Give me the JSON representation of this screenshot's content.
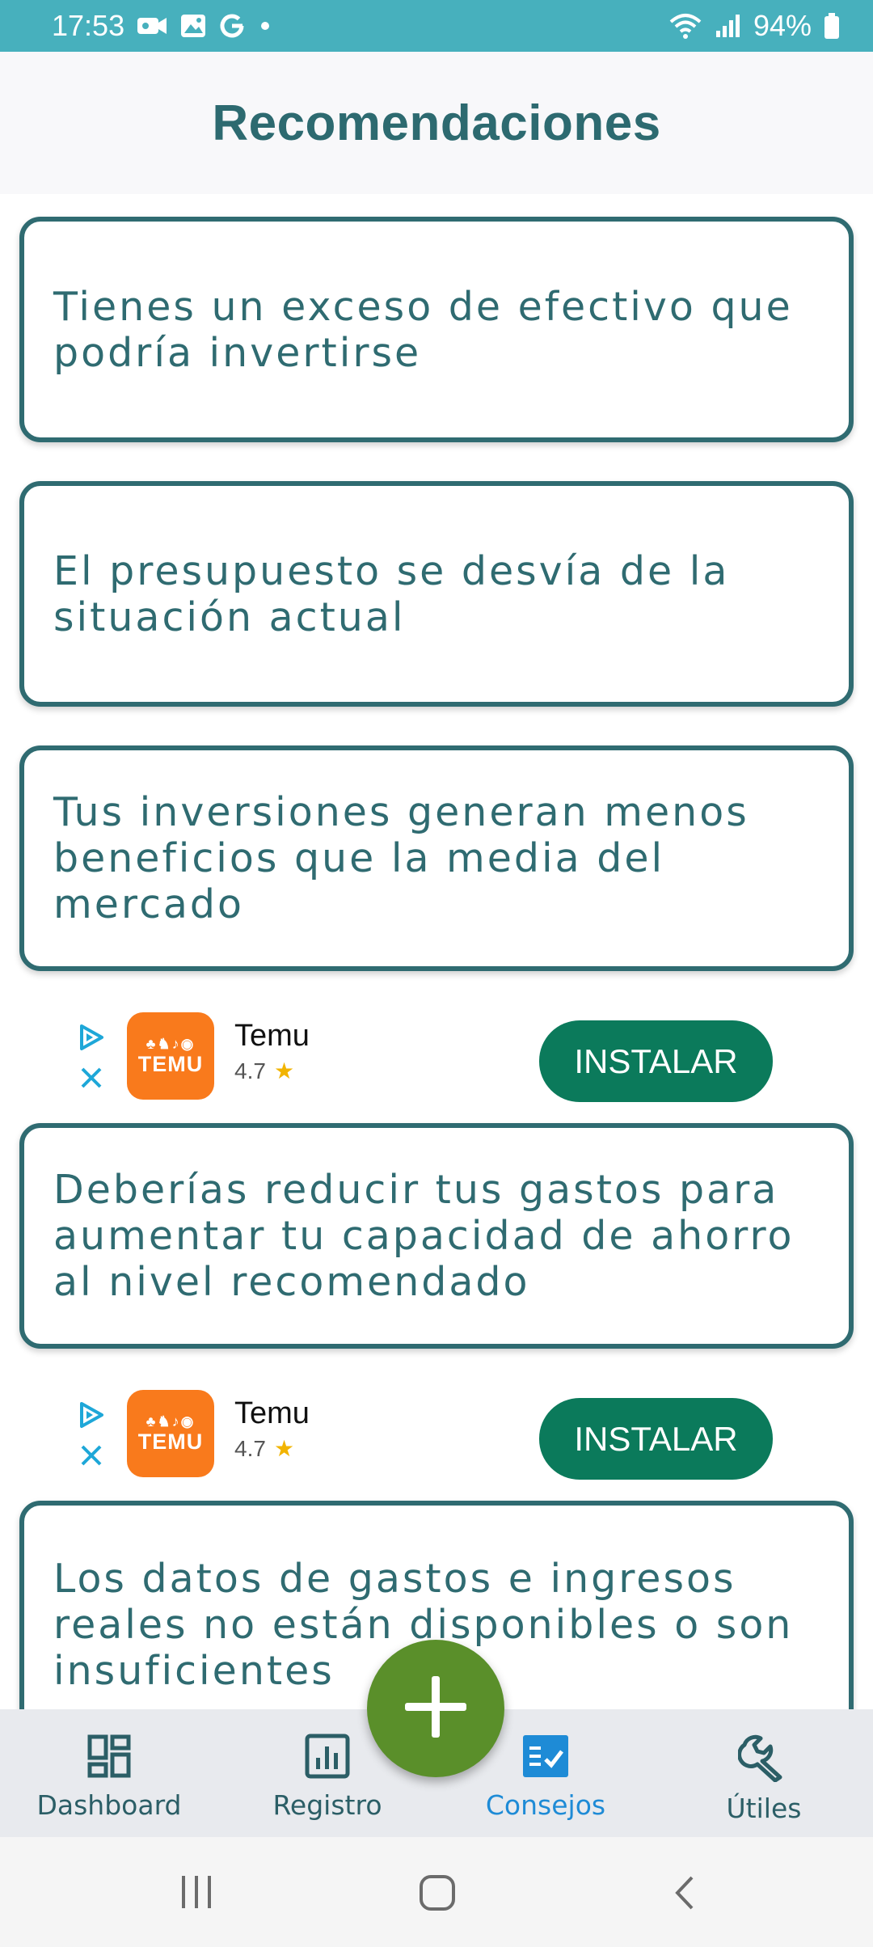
{
  "status_bar": {
    "time": "17:53",
    "notification_icons": [
      "video-icon",
      "gallery-icon",
      "google-icon",
      "dot-icon"
    ],
    "battery": "94%"
  },
  "header": {
    "title": "Recomendaciones"
  },
  "recommendations": [
    "Tienes un exceso de efectivo que podría invertirse",
    "El presupuesto se desvía de la situación actual",
    "Tus inversiones generan menos beneficios que la media del mercado",
    "Deberías reducir tus gastos para aumentar tu capacidad de ahorro al nivel recomendado",
    "Los datos de gastos e ingresos reales no están disponibles o son insuficientes"
  ],
  "ads": [
    {
      "app_name": "Temu",
      "rating": "4.7",
      "button": "INSTALAR",
      "logo_text": "TEMU"
    },
    {
      "app_name": "Temu",
      "rating": "4.7",
      "button": "INSTALAR",
      "logo_text": "TEMU"
    }
  ],
  "bottom_nav": {
    "items": [
      {
        "label": "Dashboard",
        "icon": "dashboard-icon"
      },
      {
        "label": "Registro",
        "icon": "chart-icon"
      },
      {
        "label": "Consejos",
        "icon": "checklist-icon",
        "active": true
      },
      {
        "label": "Útiles",
        "icon": "wrench-icon"
      }
    ],
    "fab_icon": "plus-icon"
  },
  "colors": {
    "status_bar": "#47b0bd",
    "title": "#2d6a70",
    "card_border": "#2f6b71",
    "install_button": "#0b7a5b",
    "fab": "#5a8f2a",
    "nav_active": "#1e8bd6",
    "temu_orange": "#f97a1c"
  }
}
